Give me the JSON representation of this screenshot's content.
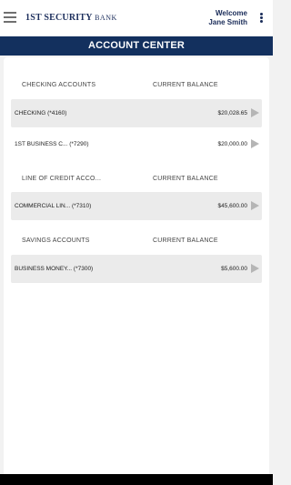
{
  "header": {
    "logo_text_1": "1ST SECURITY",
    "logo_text_2": "BANK",
    "welcome_label": "Welcome",
    "user_name": "Jane Smith"
  },
  "page_title": "ACCOUNT CENTER",
  "sections": [
    {
      "title": "CHECKING ACCOUNTS",
      "balance_header": "CURRENT BALANCE",
      "accounts": [
        {
          "name": "CHECKING (*4160)",
          "balance": "$20,028.65"
        },
        {
          "name": "1ST BUSINESS C...  (*7290)",
          "balance": "$20,000.00"
        }
      ]
    },
    {
      "title": "LINE OF CREDIT ACCO...",
      "balance_header": "CURRENT BALANCE",
      "accounts": [
        {
          "name": "COMMERCIAL LIN...  (*7310)",
          "balance": "$45,600.00"
        }
      ]
    },
    {
      "title": "SAVINGS ACCOUNTS",
      "balance_header": "CURRENT BALANCE",
      "accounts": [
        {
          "name": "BUSINESS MONEY...  (*7300)",
          "balance": "$5,600.00"
        }
      ]
    }
  ],
  "icons": {
    "menu": "hamburger-icon",
    "more": "kebab-icon",
    "row_arrow": "chevron-right-icon"
  },
  "colors": {
    "brand_navy": "#13305e",
    "background": "#f2f2f2",
    "row_shade": "#ebebeb"
  }
}
